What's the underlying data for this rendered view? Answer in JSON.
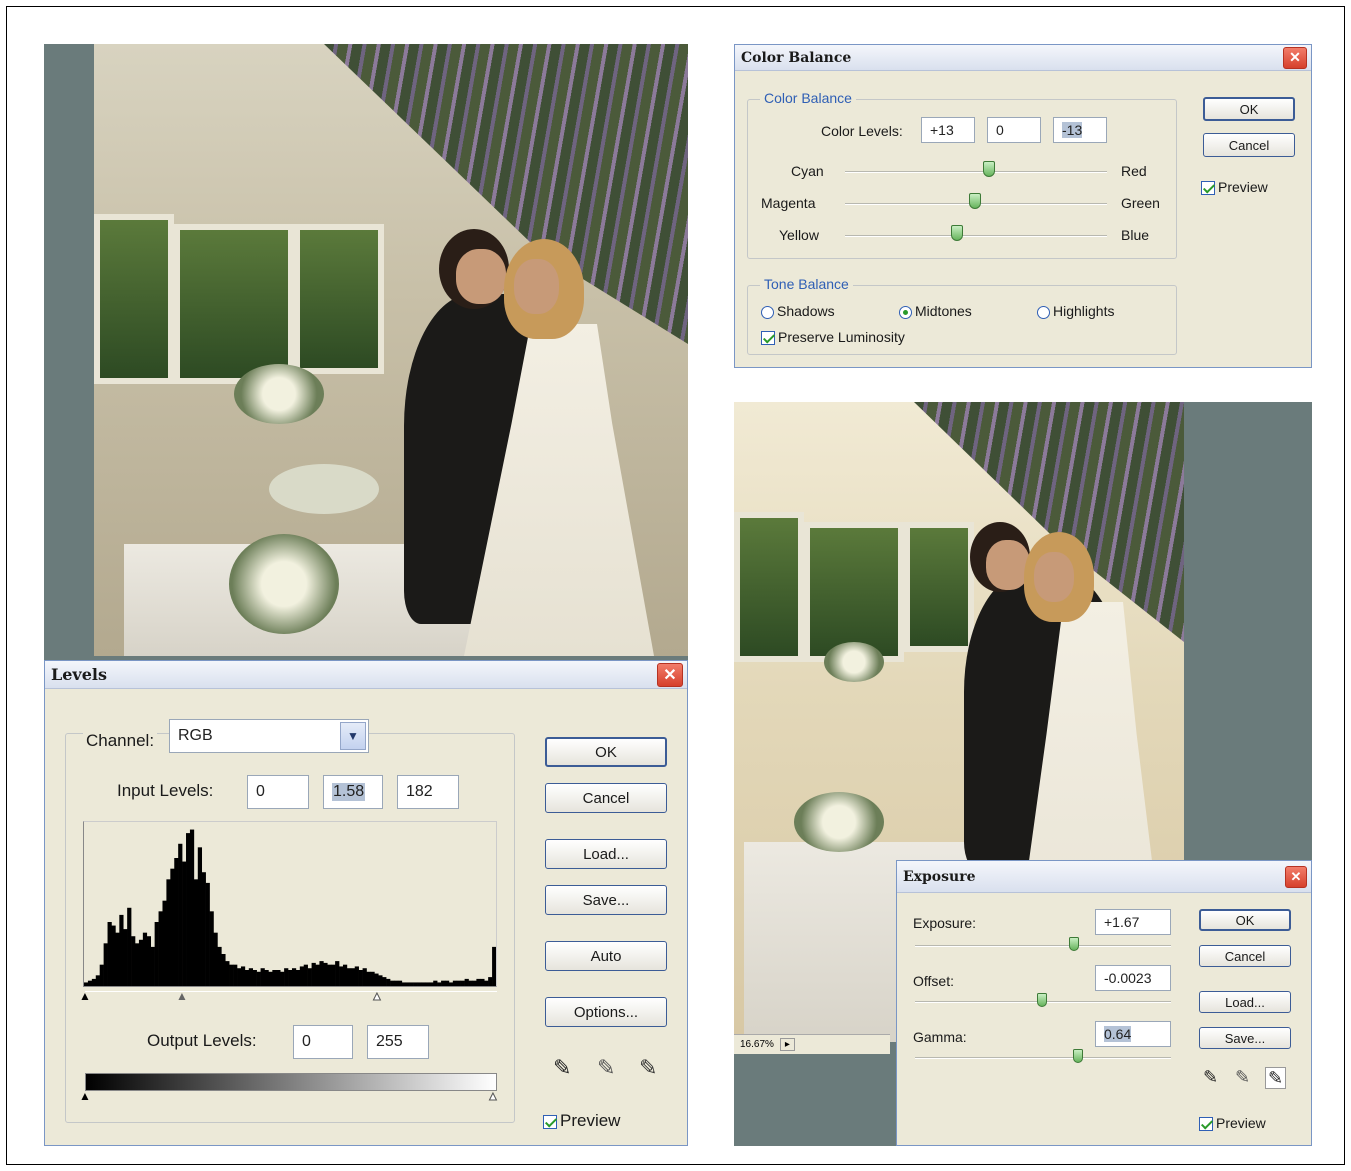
{
  "levels": {
    "title": "Levels",
    "channel_label": "Channel:",
    "channel_value": "RGB",
    "input_levels_label": "Input Levels:",
    "input_black": "0",
    "input_gamma": "1.58",
    "input_white": "182",
    "output_levels_label": "Output Levels:",
    "output_black": "0",
    "output_white": "255",
    "buttons": {
      "ok": "OK",
      "cancel": "Cancel",
      "load": "Load...",
      "save": "Save...",
      "auto": "Auto",
      "options": "Options..."
    },
    "preview_label": "Preview",
    "histogram": [
      2,
      3,
      4,
      6,
      12,
      24,
      36,
      34,
      30,
      40,
      32,
      44,
      28,
      24,
      26,
      30,
      28,
      22,
      36,
      42,
      48,
      60,
      66,
      72,
      80,
      70,
      86,
      88,
      60,
      78,
      64,
      58,
      42,
      30,
      22,
      18,
      14,
      12,
      12,
      10,
      11,
      9,
      10,
      9,
      8,
      10,
      9,
      8,
      9,
      9,
      8,
      10,
      9,
      10,
      9,
      11,
      12,
      10,
      13,
      12,
      14,
      13,
      12,
      12,
      14,
      11,
      12,
      10,
      10,
      11,
      9,
      10,
      8,
      8,
      7,
      6,
      5,
      4,
      3,
      3,
      3,
      2,
      2,
      2,
      2,
      2,
      2,
      2,
      2,
      3,
      2,
      3,
      3,
      2,
      3,
      3,
      3,
      4,
      3,
      3,
      4,
      4,
      3,
      5,
      22
    ]
  },
  "color_balance": {
    "title": "Color Balance",
    "group_label": "Color Balance",
    "levels_label": "Color Levels:",
    "level_values": [
      "+13",
      "0",
      "-13"
    ],
    "rows": [
      {
        "left": "Cyan",
        "right": "Red",
        "value": 13
      },
      {
        "left": "Magenta",
        "right": "Green",
        "value": 0
      },
      {
        "left": "Yellow",
        "right": "Blue",
        "value": -13
      }
    ],
    "tone_group_label": "Tone Balance",
    "tones": [
      "Shadows",
      "Midtones",
      "Highlights"
    ],
    "selected_tone": "Midtones",
    "preserve_label": "Preserve Luminosity",
    "buttons": {
      "ok": "OK",
      "cancel": "Cancel"
    },
    "preview_label": "Preview"
  },
  "exposure": {
    "title": "Exposure",
    "exposure_label": "Exposure:",
    "exposure_value": "+1.67",
    "offset_label": "Offset:",
    "offset_value": "-0.0023",
    "gamma_label": "Gamma:",
    "gamma_value": "0.64",
    "buttons": {
      "ok": "OK",
      "cancel": "Cancel",
      "load": "Load...",
      "save": "Save..."
    },
    "preview_label": "Preview"
  },
  "status_zoom": "16.67%",
  "colors": {
    "canvas_grey": "#6a7b7b",
    "dialog_bg": "#ece9d8",
    "accent_blue": "#2f5fb5",
    "close_red": "#d6402c"
  }
}
